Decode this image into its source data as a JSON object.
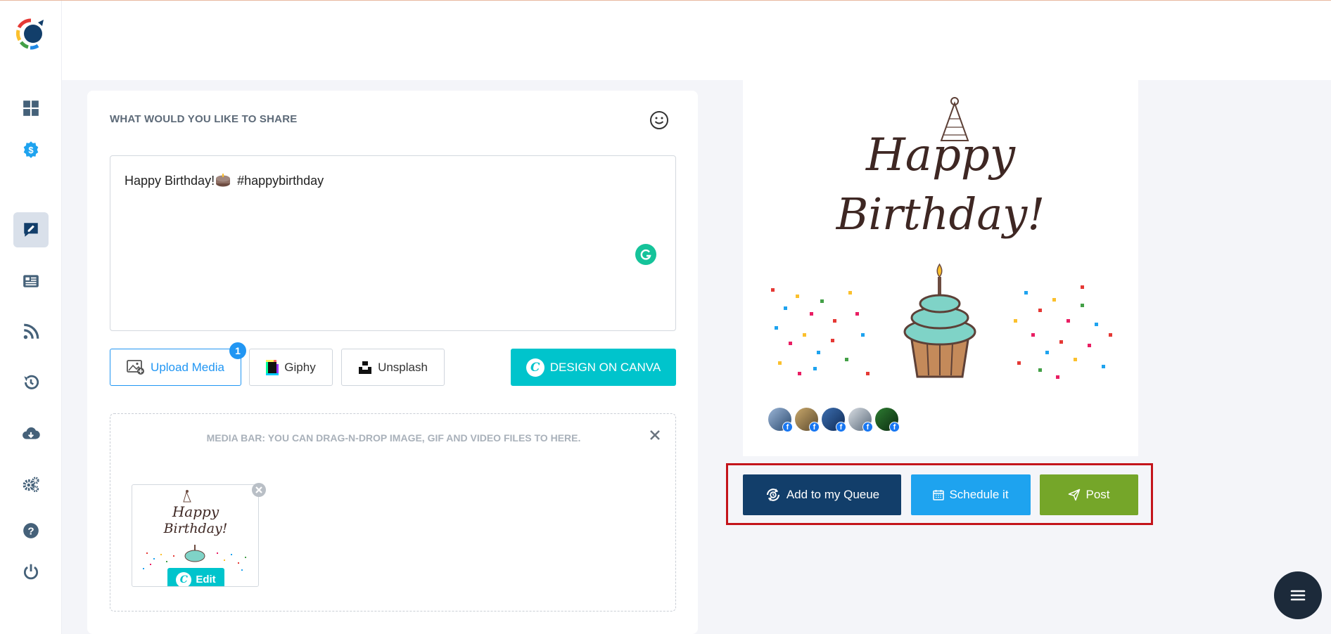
{
  "sidebar": {
    "items": [
      {
        "name": "dashboard",
        "active": false
      },
      {
        "name": "billing",
        "active": false
      },
      {
        "name": "compose",
        "active": true
      },
      {
        "name": "posts",
        "active": false
      },
      {
        "name": "rss",
        "active": false
      },
      {
        "name": "history",
        "active": false
      },
      {
        "name": "import",
        "active": false
      },
      {
        "name": "settings",
        "active": false
      },
      {
        "name": "help",
        "active": false
      },
      {
        "name": "logout",
        "active": false
      }
    ]
  },
  "composer": {
    "title": "WHAT WOULD YOU LIKE TO SHARE",
    "text_before": "Happy Birthday!",
    "text_after": " #happybirthday",
    "upload_label": "Upload Media",
    "upload_count": "1",
    "giphy_label": "Giphy",
    "unsplash_label": "Unsplash",
    "canva_label": "DESIGN ON CANVA",
    "canva_letter": "C",
    "media_bar_text": "MEDIA BAR: YOU CAN DRAG-N-DROP IMAGE, GIF AND VIDEO FILES TO HERE.",
    "edit_label": "Edit"
  },
  "preview": {
    "image_text_line1": "Happy",
    "image_text_line2": "Birthday!",
    "avatar_badge": "f",
    "avatar_count": 5
  },
  "actions": {
    "queue_label": "Add to my Queue",
    "schedule_label": "Schedule it",
    "post_label": "Post"
  },
  "colors": {
    "primary": "#123e6a",
    "schedule": "#1ea3ef",
    "post": "#75a629",
    "canva": "#00c4cc",
    "highlight": "#c4141b"
  }
}
